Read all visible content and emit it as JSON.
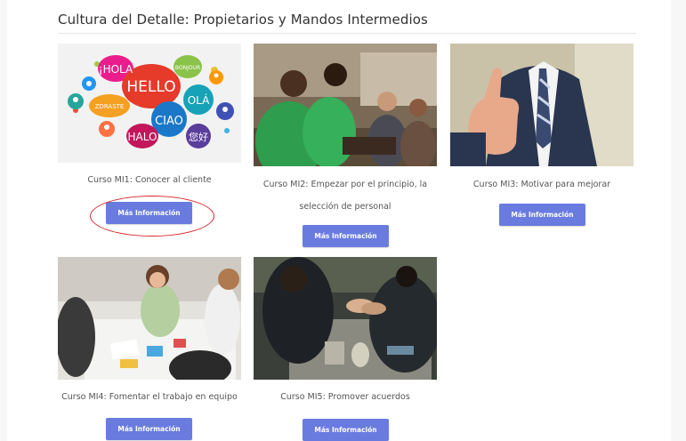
{
  "section": {
    "title": "Cultura del Detalle: Propietarios y Mandos Intermedios"
  },
  "courses": [
    {
      "caption": "Curso MI1: Conocer al cliente",
      "button_label": "Más Información",
      "image": "speech-bubbles-greetings-image",
      "image_words": [
        "¡HOLA",
        "HELLO",
        "CIAO",
        "HALO",
        "OLÁ",
        "BONJOUR",
        "ZDRASTE",
        "您好"
      ]
    },
    {
      "caption": "Curso MI2: Empezar por el principio, la selección de personal",
      "button_label": "Más Información",
      "image": "team-green-shirts-image"
    },
    {
      "caption": "Curso MI3: Motivar para mejorar",
      "button_label": "Más Información",
      "image": "thumbs-up-businessman-image"
    },
    {
      "caption": "Curso MI4: Fomentar el trabajo en equipo",
      "button_label": "Más Información",
      "image": "team-meeting-table-image"
    },
    {
      "caption": "Curso MI5: Promover acuerdos",
      "button_label": "Más Información",
      "image": "business-handshake-image"
    }
  ],
  "colors": {
    "button": "#6a7be0",
    "annotation": "#d9292c"
  }
}
